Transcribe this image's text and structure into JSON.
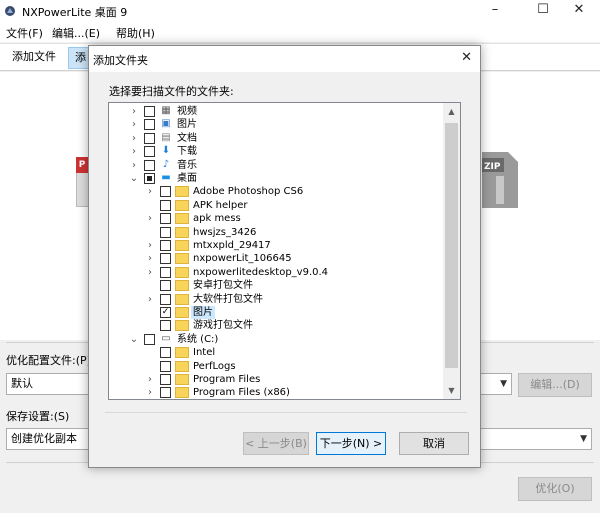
{
  "window": {
    "title": "NXPowerLite 桌面 9",
    "minimize": "–",
    "maximize": "☐",
    "close": "✕"
  },
  "menu": [
    "文件(F)",
    "编辑...(E)",
    "帮助(H)"
  ],
  "tabs": [
    "添加文件",
    "添"
  ],
  "settings": {
    "optimize_label": "优化配置文件:(P)",
    "optimize_value": "默认",
    "edit_button": "编辑...(D)",
    "save_label": "保存设置:(S)",
    "save_value": "创建优化副本",
    "optimize_button": "优化(O)"
  },
  "dialog": {
    "title": "添加文件夹",
    "close": "✕",
    "prompt": "选择要扫描文件的文件夹:",
    "prev_button": "< 上一步(B)",
    "next_button": "下一步(N) >",
    "cancel_button": "取消",
    "tree": [
      {
        "label": "视频",
        "level": 0,
        "expander": "›",
        "checked": "none",
        "icon": "video"
      },
      {
        "label": "图片",
        "level": 0,
        "expander": "›",
        "checked": "none",
        "icon": "picture"
      },
      {
        "label": "文档",
        "level": 0,
        "expander": "›",
        "checked": "none",
        "icon": "document"
      },
      {
        "label": "下载",
        "level": 0,
        "expander": "›",
        "checked": "none",
        "icon": "download"
      },
      {
        "label": "音乐",
        "level": 0,
        "expander": "›",
        "checked": "none",
        "icon": "music"
      },
      {
        "label": "桌面",
        "level": 0,
        "expander": "⌄",
        "checked": "partial",
        "icon": "desktop"
      },
      {
        "label": "Adobe Photoshop CS6",
        "level": 1,
        "expander": "›",
        "checked": "none",
        "icon": "folder"
      },
      {
        "label": "APK helper",
        "level": 1,
        "expander": "",
        "checked": "none",
        "icon": "folder"
      },
      {
        "label": "apk mess",
        "level": 1,
        "expander": "›",
        "checked": "none",
        "icon": "folder"
      },
      {
        "label": "hwsjzs_3426",
        "level": 1,
        "expander": "",
        "checked": "none",
        "icon": "folder"
      },
      {
        "label": "mtxxpld_29417",
        "level": 1,
        "expander": "›",
        "checked": "none",
        "icon": "folder"
      },
      {
        "label": "nxpowerLit_106645",
        "level": 1,
        "expander": "›",
        "checked": "none",
        "icon": "folder"
      },
      {
        "label": "nxpowerlitedesktop_v9.0.4",
        "level": 1,
        "expander": "›",
        "checked": "none",
        "icon": "folder"
      },
      {
        "label": "安卓打包文件",
        "level": 1,
        "expander": "",
        "checked": "none",
        "icon": "folder"
      },
      {
        "label": "大软件打包文件",
        "level": 1,
        "expander": "›",
        "checked": "none",
        "icon": "folder"
      },
      {
        "label": "图片",
        "level": 1,
        "expander": "",
        "checked": "checked",
        "icon": "folder",
        "selected": true
      },
      {
        "label": "游戏打包文件",
        "level": 1,
        "expander": "",
        "checked": "none",
        "icon": "folder"
      },
      {
        "label": "系统 (C:)",
        "level": 0,
        "expander": "⌄",
        "checked": "none",
        "icon": "drive"
      },
      {
        "label": "Intel",
        "level": 1,
        "expander": "",
        "checked": "none",
        "icon": "folder"
      },
      {
        "label": "PerfLogs",
        "level": 1,
        "expander": "",
        "checked": "none",
        "icon": "folder"
      },
      {
        "label": "Program Files",
        "level": 1,
        "expander": "›",
        "checked": "none",
        "icon": "folder"
      },
      {
        "label": "Program Files (x86)",
        "level": 1,
        "expander": "›",
        "checked": "none",
        "icon": "folder"
      }
    ]
  }
}
